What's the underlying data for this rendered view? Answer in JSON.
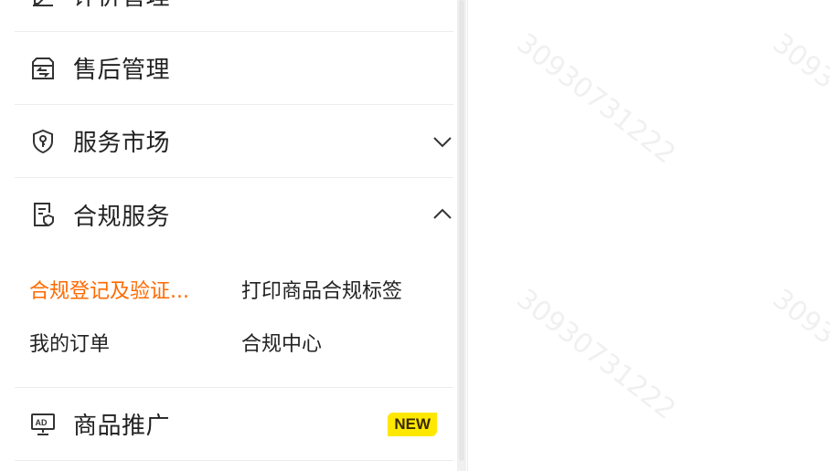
{
  "menu": {
    "top_partial_label": "评价管理",
    "aftersale_label": "售后管理",
    "service_market_label": "服务市场",
    "compliance_label": "合规服务",
    "promotion_label": "商品推广",
    "promotion_badge": "NEW"
  },
  "compliance_submenu": {
    "item1": "合规登记及验证...",
    "item2": "打印商品合规标签",
    "item3": "我的订单",
    "item4": "合规中心"
  },
  "watermark": {
    "text": "30930731222"
  },
  "colors": {
    "active": "#ff6a00",
    "badge_bg": "#ffe800",
    "text": "#222222",
    "divider": "#ececec"
  }
}
